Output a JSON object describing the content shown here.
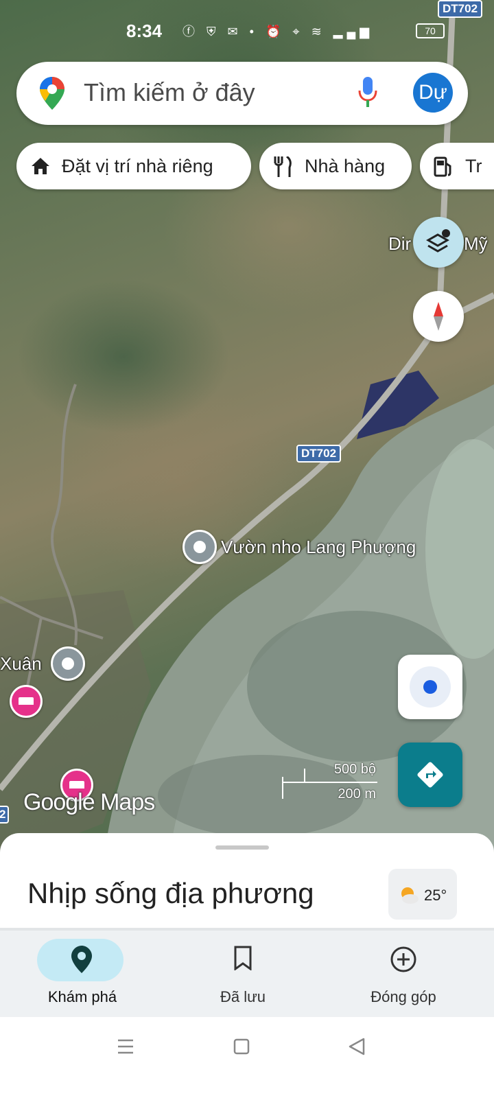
{
  "status_bar": {
    "time": "8:34",
    "battery": "70",
    "icons": [
      "facebook-icon",
      "shield-app-icon",
      "messenger-icon",
      "dot-icon",
      "alarm-icon",
      "location-icon",
      "wifi-icon",
      "signal-icon"
    ]
  },
  "search": {
    "placeholder": "Tìm kiếm ở đây",
    "avatar_letter": "Dự"
  },
  "chips": [
    {
      "label": "Đặt vị trí nhà riêng",
      "icon": "home-icon"
    },
    {
      "label": "Nhà hàng",
      "icon": "restaurant-icon"
    },
    {
      "label": "Tr",
      "icon": "gas-station-icon"
    }
  ],
  "map": {
    "roads": [
      "DT702",
      "DT702"
    ],
    "labels": {
      "top_right": "Dir",
      "top_right_2": "Mỹ",
      "poi_main": "Vườn nho Lang Phượng",
      "poi_left": "Xuân",
      "edge_left": "2"
    },
    "brand": "Google Maps",
    "scale": {
      "imperial": "500 bộ",
      "metric": "200 m"
    }
  },
  "sheet": {
    "title": "Nhịp sống địa phương",
    "weather": {
      "temp": "25°",
      "icon": "partly-cloudy-icon"
    }
  },
  "nav": {
    "tabs": [
      {
        "label": "Khám phá",
        "icon": "explore-pin-icon",
        "active": true
      },
      {
        "label": "Đã lưu",
        "icon": "bookmark-icon",
        "active": false
      },
      {
        "label": "Đóng góp",
        "icon": "add-circle-icon",
        "active": false
      }
    ]
  },
  "colors": {
    "accent": "#1976d2",
    "teal": "#0b7d8c",
    "active_pill": "#c4eaf5",
    "poi_pink": "#e5318a"
  }
}
